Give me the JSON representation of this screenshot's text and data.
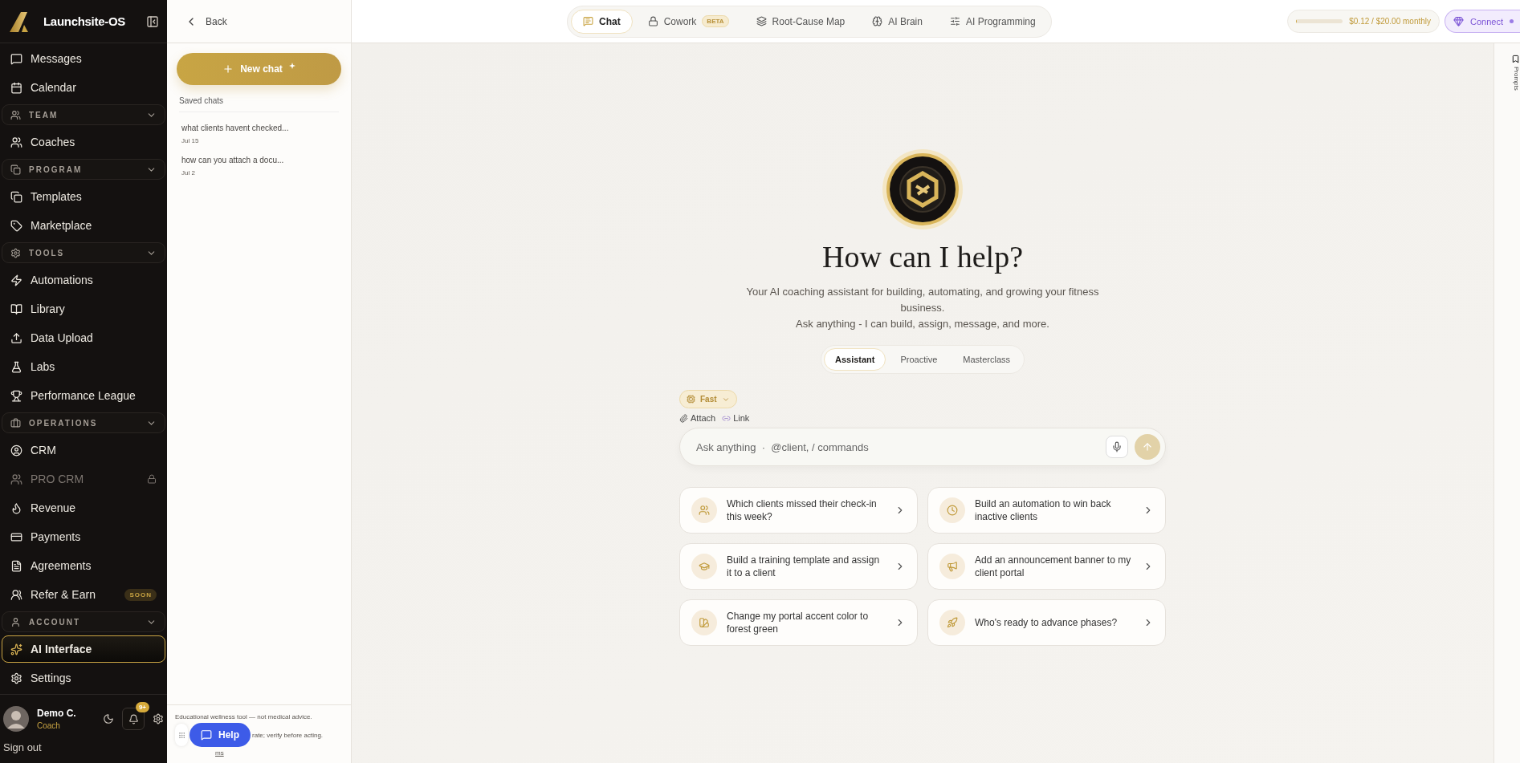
{
  "sidebar": {
    "brand": "Launchsite-OS",
    "items": [
      {
        "kind": "item",
        "label": "Messages",
        "selected": false
      },
      {
        "kind": "item",
        "label": "Calendar",
        "selected": false
      },
      {
        "kind": "section",
        "label": "TEAM",
        "expanded": true
      },
      {
        "kind": "item",
        "label": "Coaches",
        "selected": false
      },
      {
        "kind": "section",
        "label": "PROGRAM",
        "expanded": true
      },
      {
        "kind": "item",
        "label": "Templates",
        "selected": false
      },
      {
        "kind": "item",
        "label": "Marketplace",
        "selected": false
      },
      {
        "kind": "section",
        "label": "TOOLS",
        "expanded": true
      },
      {
        "kind": "item",
        "label": "Automations",
        "selected": false
      },
      {
        "kind": "item",
        "label": "Library",
        "selected": false
      },
      {
        "kind": "item",
        "label": "Data Upload",
        "selected": false
      },
      {
        "kind": "item",
        "label": "Labs",
        "selected": false
      },
      {
        "kind": "item",
        "label": "Performance League",
        "selected": false
      },
      {
        "kind": "section",
        "label": "OPERATIONS",
        "expanded": true
      },
      {
        "kind": "item",
        "label": "CRM",
        "selected": false
      },
      {
        "kind": "item",
        "label": "PRO CRM",
        "selected": false,
        "disabled": true
      },
      {
        "kind": "item",
        "label": "Revenue",
        "selected": false
      },
      {
        "kind": "item",
        "label": "Payments",
        "selected": false
      },
      {
        "kind": "item",
        "label": "Agreements",
        "selected": false
      },
      {
        "kind": "item",
        "label": "Refer & Earn",
        "selected": false,
        "badge": "SOON"
      },
      {
        "kind": "section",
        "label": "ACCOUNT",
        "expanded": true
      },
      {
        "kind": "item",
        "label": "AI Interface",
        "selected": true
      },
      {
        "kind": "item",
        "label": "Settings",
        "selected": false
      }
    ],
    "user": {
      "name": "Demo C.",
      "role": "Coach",
      "notifications": "9+"
    },
    "sign_out": "Sign out"
  },
  "chat_panel": {
    "back": "Back",
    "new_chat": "New chat",
    "saved_title": "Saved chats",
    "chats": [
      {
        "title": "what clients havent checked...",
        "date": "Jul 15"
      },
      {
        "title": "how can you attach a docu...",
        "date": "Jul 2"
      }
    ],
    "disclaimer": "Educational wellness tool — not medical advice.",
    "disclaimer_tail": "rate; verify before acting.",
    "disclaimer_link": "ms",
    "help": "Help"
  },
  "topbar": {
    "tabs": [
      {
        "label": "Chat",
        "selected": true
      },
      {
        "label": "Cowork",
        "badge": "BETA",
        "selected": false
      },
      {
        "label": "Root-Cause Map",
        "selected": false
      },
      {
        "label": "AI Brain",
        "selected": false
      },
      {
        "label": "AI Programming",
        "selected": false
      }
    ],
    "usage": {
      "level": 0.01,
      "text": "$0.12 / $20.00 monthly"
    },
    "connect": "Connect"
  },
  "main": {
    "title": "How can I help?",
    "subtitle": [
      "Your AI coaching assistant for building, automating, and growing your fitness business.",
      "Ask anything - I can build, assign, message, and more."
    ],
    "modes": [
      {
        "label": "Assistant",
        "selected": true
      },
      {
        "label": "Proactive",
        "selected": false
      },
      {
        "label": "Masterclass",
        "selected": false
      }
    ],
    "speed": "Fast",
    "attach": "Attach",
    "link": "Link",
    "placeholder": "Ask anything  ·  @client, / commands",
    "suggestions": [
      "Which clients missed their check-in this week?",
      "Build an automation to win back inactive clients",
      "Build a training template and assign it to a client",
      "Add an announcement banner to my client portal",
      "Change my portal accent color to forest green",
      "Who's ready to advance phases?"
    ]
  },
  "right_rail": {
    "label": "Prompts"
  }
}
